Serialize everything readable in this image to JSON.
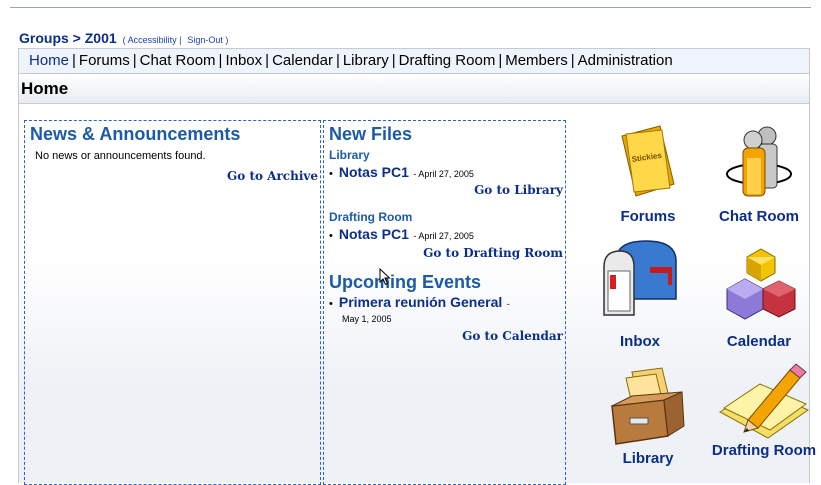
{
  "header": {
    "groups_label": "Groups",
    "separator": ">",
    "group_name": "Z001",
    "accessibility_label": "( Accessibility |",
    "signout_label": "Sign-Out )"
  },
  "nav": {
    "items": [
      "Home",
      "Forums",
      "Chat Room",
      "Inbox",
      "Calendar",
      "Library",
      "Drafting Room",
      "Members",
      "Administration"
    ],
    "separator": "|"
  },
  "page_title": "Home",
  "news": {
    "title": "News & Announcements",
    "empty_text": "No news or announcements found.",
    "archive_link": "Go to Archive"
  },
  "new_files": {
    "title": "New Files",
    "sections": [
      {
        "title": "Library",
        "item": "Notas PC1",
        "date": "- April 27, 2005",
        "link": "Go to Library"
      },
      {
        "title": "Drafting Room",
        "item": "Notas PC1",
        "date": "- April 27, 2005",
        "link": "Go to Drafting Room"
      }
    ]
  },
  "events": {
    "title": "Upcoming Events",
    "item": "Primera reunión General",
    "dash": "-",
    "date": "May 1, 2005",
    "link": "Go to Calendar"
  },
  "tools": [
    {
      "label": "Forums",
      "icon": "stickies-folder-icon",
      "color": "#f2c200"
    },
    {
      "label": "Chat Room",
      "icon": "people-icon",
      "color": "#f29a00"
    },
    {
      "label": "Inbox",
      "icon": "mailbox-icon",
      "color": "#2f6fc3"
    },
    {
      "label": "Calendar",
      "icon": "cubes-icon",
      "color": "#8a73d6"
    },
    {
      "label": "Library",
      "icon": "file-box-icon",
      "color": "#b57a3e"
    },
    {
      "label": "Drafting Room",
      "icon": "pencil-paper-icon",
      "color": "#f0d44a"
    }
  ],
  "icon_sticky_text": "Stickies"
}
